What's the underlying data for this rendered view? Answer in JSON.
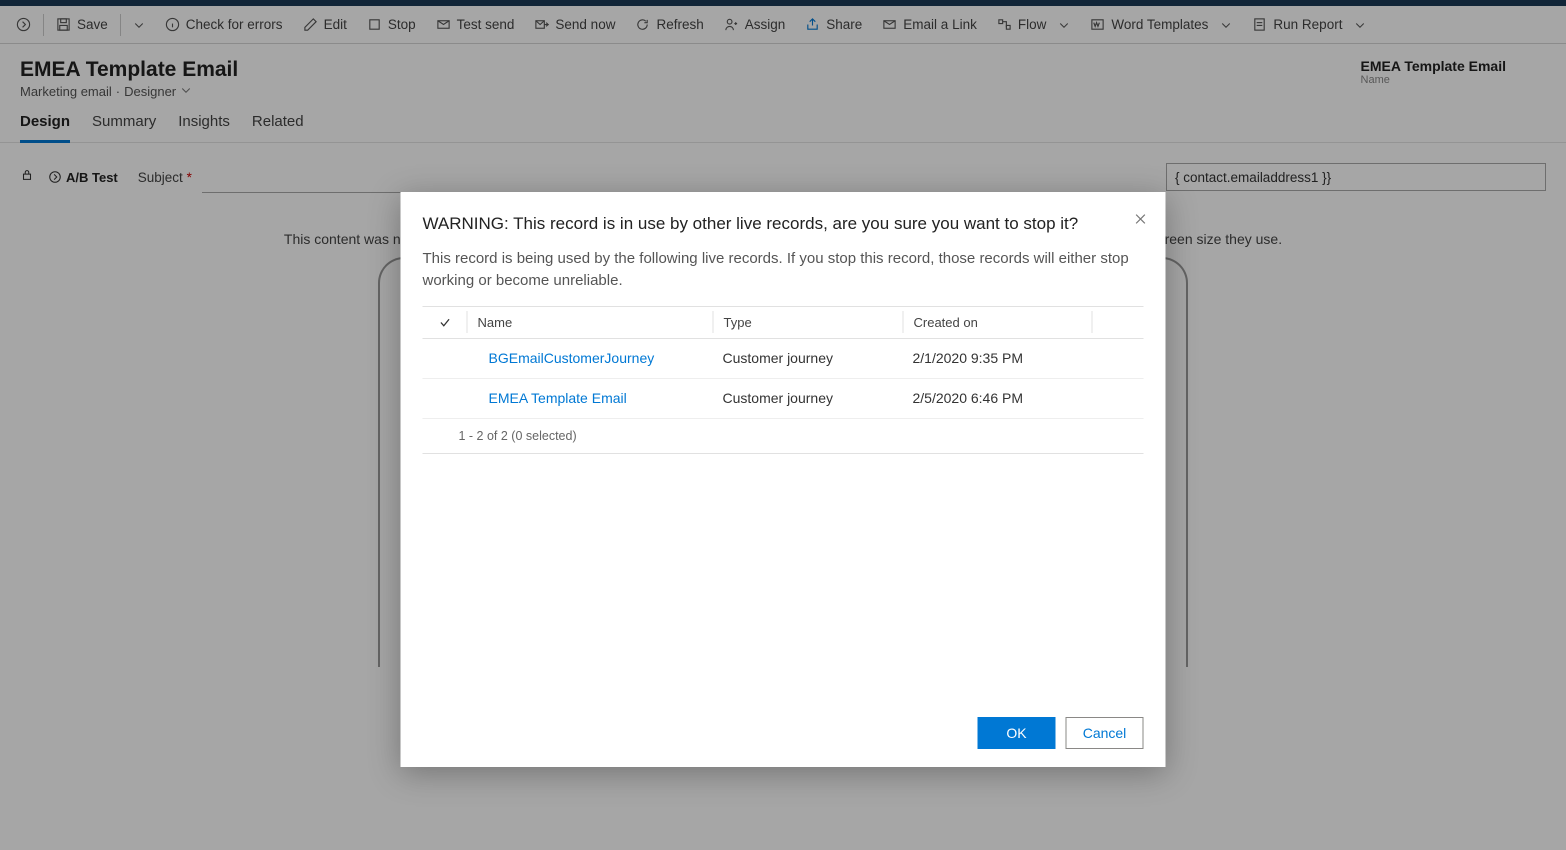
{
  "commands": {
    "save": "Save",
    "check": "Check for errors",
    "edit": "Edit",
    "stop": "Stop",
    "test_send": "Test send",
    "send_now": "Send now",
    "refresh": "Refresh",
    "assign": "Assign",
    "share": "Share",
    "email_link": "Email a Link",
    "flow": "Flow",
    "word_templates": "Word Templates",
    "run_report": "Run Report"
  },
  "header": {
    "title": "EMEA Template Email",
    "subtitle_a": "Marketing email",
    "subtitle_sep": "·",
    "subtitle_b": "Designer",
    "right_value": "EMEA Template Email",
    "right_label": "Name"
  },
  "tabs": {
    "design": "Design",
    "summary": "Summary",
    "insights": "Insights",
    "related": "Related"
  },
  "designer": {
    "ab": "A/B Test",
    "subject_label": "Subject",
    "to_value": "{ contact.emailaddress1 }}",
    "notice": "This content was not generated for the selected preview settings. Recipients may see different content depending on which email client and screen size they use."
  },
  "modal": {
    "title": "WARNING: This record is in use by other live records, are you sure you want to stop it?",
    "body": "This record is being used by the following live records. If you stop this record, those records will either stop working or become unreliable.",
    "cols": {
      "name": "Name",
      "type": "Type",
      "created": "Created on"
    },
    "rows": [
      {
        "name": "BGEmailCustomerJourney",
        "type": "Customer journey",
        "created": "2/1/2020 9:35 PM"
      },
      {
        "name": "EMEA Template Email",
        "type": "Customer journey",
        "created": "2/5/2020 6:46 PM"
      }
    ],
    "footer": "1 - 2 of 2 (0 selected)",
    "ok": "OK",
    "cancel": "Cancel"
  }
}
